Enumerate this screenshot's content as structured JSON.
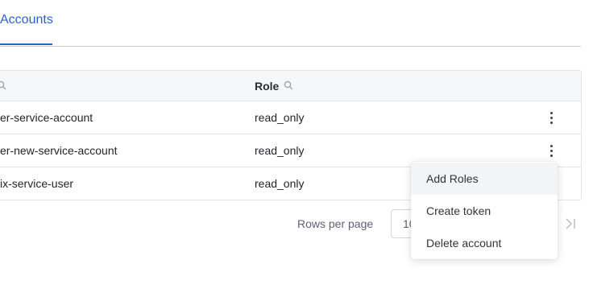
{
  "tabs": {
    "active_label": "Accounts"
  },
  "table": {
    "headers": {
      "name": "",
      "role": "Role"
    },
    "rows": [
      {
        "name": "er-service-account",
        "role": "read_only"
      },
      {
        "name": "er-new-service-account",
        "role": "read_only"
      },
      {
        "name": "ix-service-user",
        "role": "read_only"
      }
    ]
  },
  "pagination": {
    "rows_per_page_label": "Rows per page",
    "rows_per_page_value": "10"
  },
  "menu": {
    "items": [
      "Add Roles",
      "Create token",
      "Delete account"
    ]
  },
  "icons": {
    "search": "search-icon",
    "more": "more-vertical-icon",
    "last_page": "last-page-icon"
  },
  "colors": {
    "accent": "#2d5fd3",
    "header_bg": "#f6f7f8",
    "border": "#e3e5e8"
  }
}
